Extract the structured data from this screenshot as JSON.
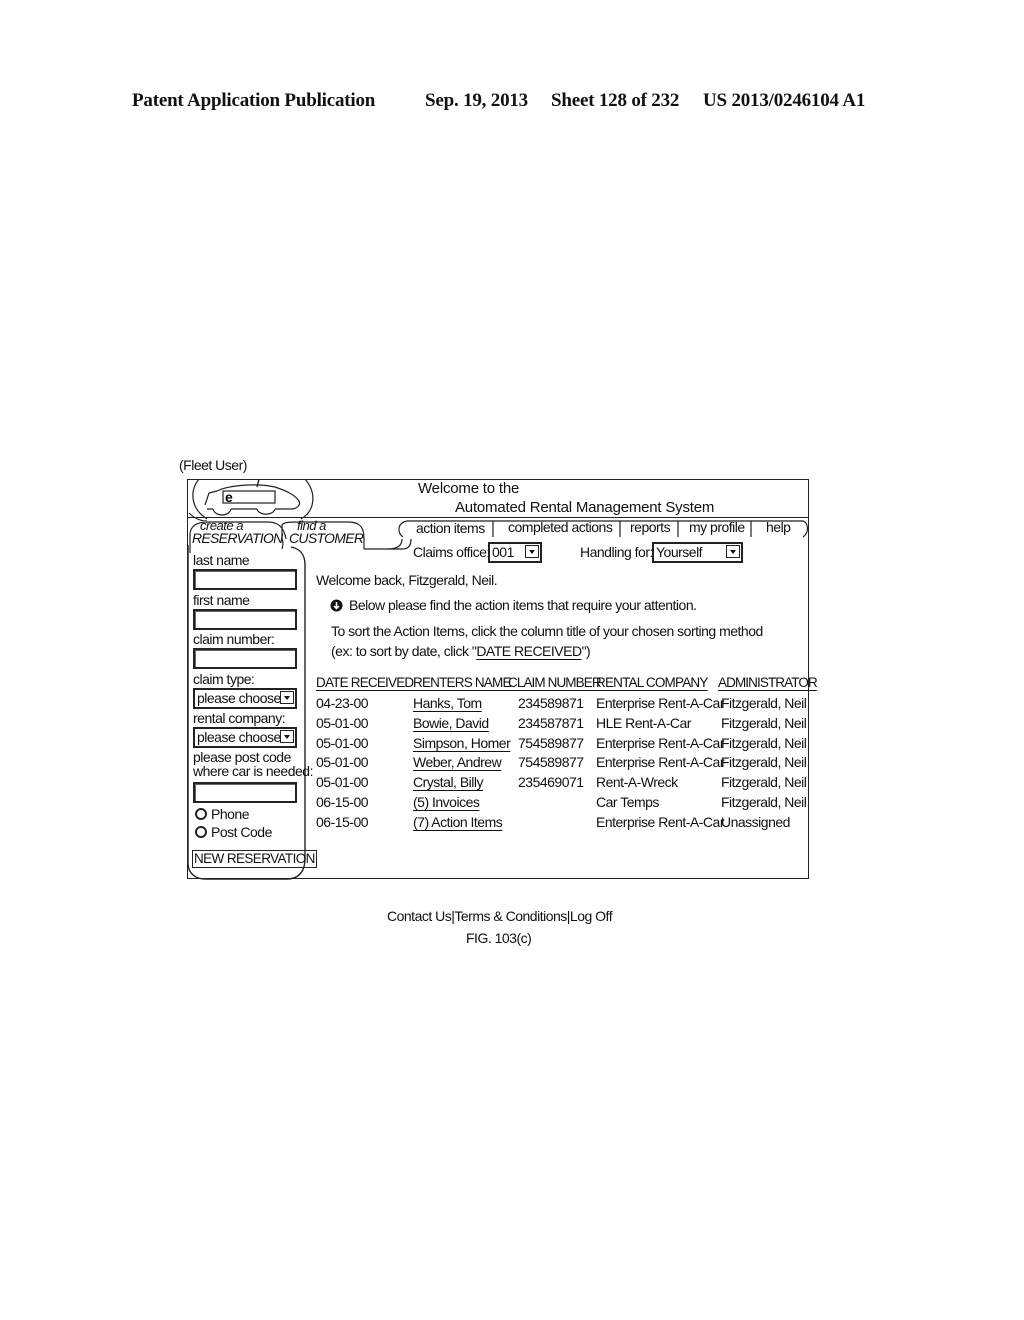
{
  "patent_header": {
    "publication": "Patent Application Publication",
    "date": "Sep. 19, 2013",
    "sheet": "Sheet 128 of 232",
    "number": "US 2013/0246104 A1"
  },
  "figure": {
    "user_label": "(Fleet User)",
    "caption": "FIG. 103(c)"
  },
  "app": {
    "logo_icon": "car-logo-icon",
    "logo_letter": "e",
    "title_line1": "Welcome to the",
    "title_line2": "Automated Rental Management System"
  },
  "side_tabs": [
    {
      "small": "create a",
      "big": "RESERVATION"
    },
    {
      "small": "find a",
      "big": "CUSTOMER"
    }
  ],
  "nav": {
    "items": [
      "action items",
      "completed actions",
      "reports",
      "my profile",
      "help"
    ]
  },
  "filters": {
    "claims_office_label": "Claims office:",
    "claims_office_value": "001",
    "handling_for_label": "Handling for:",
    "handling_for_value": "Yourself"
  },
  "reservation_form": {
    "last_name_label": "last name",
    "last_name_value": "",
    "first_name_label": "first name",
    "first_name_value": "",
    "claim_number_label": "claim number:",
    "claim_number_value": "",
    "claim_type_label": "claim type:",
    "claim_type_value": "please choose",
    "rental_company_label": "rental company:",
    "rental_company_value": "please choose",
    "post_code_label_1": "please post code",
    "post_code_label_2": "where car is needed:",
    "post_code_value": "",
    "radio_phone": "Phone",
    "radio_post_code": "Post Code",
    "submit_label": "NEW RESERVATION"
  },
  "main": {
    "welcome": "Welcome back, Fitzgerald, Neil.",
    "notice_icon": "down-arrow-circle-icon",
    "notice": "Below please find the action items that require your attention.",
    "sort_help_1": "To sort the Action Items, click the column title of your chosen sorting method",
    "sort_help_2_prefix": "(ex: to sort by date, click \"",
    "sort_help_2_link": "DATE RECEIVED",
    "sort_help_2_suffix": "\")"
  },
  "table": {
    "columns": [
      "DATE RECEIVED",
      "RENTERS NAME",
      "CLAIM NUMBER",
      "RENTAL COMPANY",
      "ADMINISTRATOR"
    ],
    "rows": [
      [
        "04-23-00",
        "Hanks, Tom",
        "234589871",
        "Enterprise Rent-A-Car",
        "Fitzgerald, Neil"
      ],
      [
        "05-01-00",
        "Bowie, David",
        "234587871",
        "HLE Rent-A-Car",
        "Fitzgerald, Neil"
      ],
      [
        "05-01-00",
        "Simpson, Homer",
        "754589877",
        "Enterprise Rent-A-Car",
        "Fitzgerald, Neil"
      ],
      [
        "05-01-00",
        "Weber, Andrew",
        "754589877",
        "Enterprise Rent-A-Car",
        "Fitzgerald, Neil"
      ],
      [
        "05-01-00",
        "Crystal, Billy",
        "235469071",
        "Rent-A-Wreck",
        "Fitzgerald, Neil"
      ],
      [
        "06-15-00",
        "(5) Invoices",
        "",
        "Car Temps",
        "Fitzgerald, Neil"
      ],
      [
        "06-15-00",
        "(7) Action Items",
        "",
        "Enterprise Rent-A-Car",
        "Unassigned"
      ]
    ]
  },
  "footer": {
    "links": [
      "Contact Us",
      "Terms & Conditions",
      "Log Off"
    ],
    "separator": "|"
  }
}
